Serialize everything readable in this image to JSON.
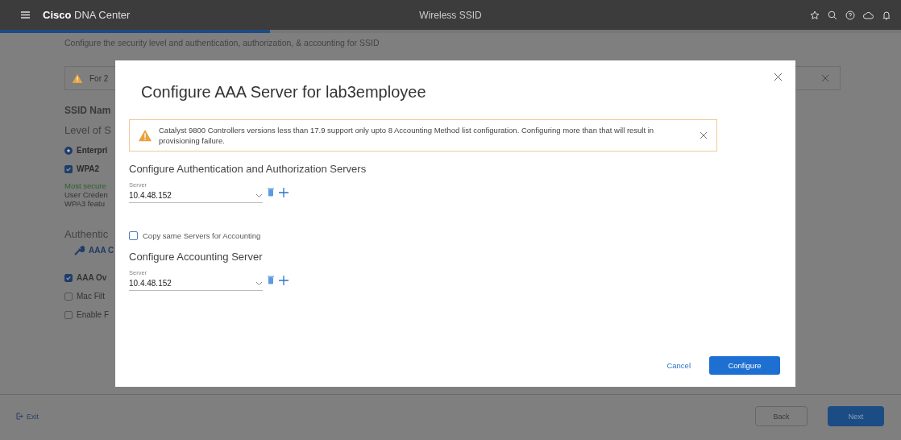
{
  "header": {
    "brand": "**Cisco** DNA Center",
    "title": "Wireless SSID"
  },
  "progress": {
    "level": 0.3
  },
  "page": {
    "subtitle": "Configure the security level and authentication, authorization, & accounting for SSID",
    "warning": {
      "text": "For 2"
    },
    "section_title": "SSID Nam",
    "level_label": "Level of S",
    "options": [
      {
        "kind": "radio",
        "label": "Enterpri",
        "checked": true
      },
      {
        "kind": "checkbox",
        "label": "WPA2",
        "checked": true
      }
    ],
    "description": [
      {
        "text": "Most secure",
        "kind": "success"
      },
      {
        "text": "User Creden",
        "kind": "plain"
      },
      {
        "text": "WPA3 featu",
        "kind": "plain"
      }
    ],
    "auth_label": "Authentic",
    "aaa_link": "AAA C",
    "checks": [
      {
        "label": "AAA Ov",
        "checked": true
      },
      {
        "label": "Mac Filt",
        "checked": false
      },
      {
        "label": "Enable F",
        "checked": false
      }
    ]
  },
  "dialog": {
    "title": "Configure AAA Server for lab3employee",
    "alert": "Catalyst 9800 Controllers versions less than 17.9 support only upto 8 Accounting Method list configuration. Configuring more than that will result in provisioning failure.",
    "auth_heading": "Configure Authentication and Authorization Servers",
    "auth_server": {
      "label": "Server",
      "value": "10.4.48.152"
    },
    "copy_checkbox": {
      "label": "Copy same Servers for Accounting",
      "checked": false
    },
    "acct_heading": "Configure Accounting Server",
    "acct_server": {
      "label": "Server",
      "value": "10.4.48.152"
    },
    "buttons": {
      "cancel": "Cancel",
      "confirm": "Configure"
    }
  },
  "footer": {
    "exit": "Exit",
    "back": "Back",
    "next": "Next"
  }
}
